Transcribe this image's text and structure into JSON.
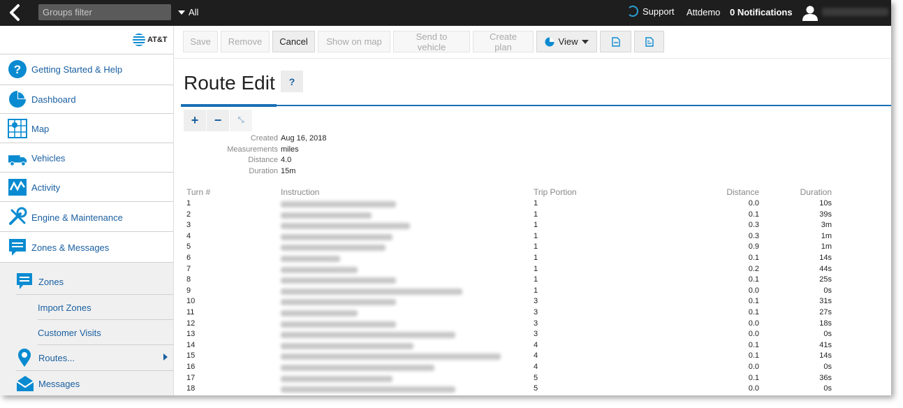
{
  "topbar": {
    "groups_filter_placeholder": "Groups filter",
    "all_label": "All",
    "support_label": "Support",
    "account_label": "Attdemo",
    "notifications_label": "0 Notifications"
  },
  "brand": {
    "logo_text": "AT&T",
    "accent_color": "#1a6fb5",
    "icon_color": "#0a8bd1"
  },
  "sidebar": {
    "items": [
      {
        "label": "Getting Started & Help",
        "icon": "help-icon"
      },
      {
        "label": "Dashboard",
        "icon": "pie-chart-icon"
      },
      {
        "label": "Map",
        "icon": "map-icon"
      },
      {
        "label": "Vehicles",
        "icon": "truck-icon"
      },
      {
        "label": "Activity",
        "icon": "activity-icon"
      },
      {
        "label": "Engine & Maintenance",
        "icon": "wrench-icon"
      },
      {
        "label": "Zones & Messages",
        "icon": "message-icon"
      }
    ],
    "subitems": [
      {
        "label": "Zones",
        "icon": "zone-icon"
      },
      {
        "label": "Import Zones"
      },
      {
        "label": "Customer Visits"
      },
      {
        "label": "Routes...",
        "icon": "pin-icon"
      },
      {
        "label": "Messages",
        "icon": "envelope-icon"
      }
    ]
  },
  "toolbar": {
    "save": "Save",
    "remove": "Remove",
    "cancel": "Cancel",
    "show_on_map": "Show on map",
    "send_to_vehicle": "Send to vehicle",
    "create_plan": "Create plan",
    "view": "View"
  },
  "page": {
    "title": "Route Edit",
    "help": "?"
  },
  "meta": [
    {
      "key": "Created",
      "value": "Aug 16, 2018"
    },
    {
      "key": "Measurements",
      "value": "miles"
    },
    {
      "key": "Distance",
      "value": "4.0"
    },
    {
      "key": "Duration",
      "value": "15m"
    }
  ],
  "table": {
    "headers": {
      "turn": "Turn #",
      "instruction": "Instruction",
      "trip": "Trip Portion",
      "distance": "Distance",
      "duration": "Duration"
    },
    "rows": [
      {
        "turn": "1",
        "trip": "1",
        "distance": "0.0",
        "duration": "10s"
      },
      {
        "turn": "2",
        "trip": "1",
        "distance": "0.1",
        "duration": "39s"
      },
      {
        "turn": "3",
        "trip": "1",
        "distance": "0.3",
        "duration": "3m"
      },
      {
        "turn": "4",
        "trip": "1",
        "distance": "0.3",
        "duration": "1m"
      },
      {
        "turn": "5",
        "trip": "1",
        "distance": "0.9",
        "duration": "1m"
      },
      {
        "turn": "6",
        "trip": "1",
        "distance": "0.1",
        "duration": "14s"
      },
      {
        "turn": "7",
        "trip": "1",
        "distance": "0.2",
        "duration": "44s"
      },
      {
        "turn": "8",
        "trip": "1",
        "distance": "0.1",
        "duration": "25s"
      },
      {
        "turn": "9",
        "trip": "1",
        "distance": "0.0",
        "duration": "0s"
      },
      {
        "turn": "10",
        "trip": "3",
        "distance": "0.1",
        "duration": "31s"
      },
      {
        "turn": "11",
        "trip": "3",
        "distance": "0.1",
        "duration": "27s"
      },
      {
        "turn": "12",
        "trip": "3",
        "distance": "0.0",
        "duration": "18s"
      },
      {
        "turn": "13",
        "trip": "3",
        "distance": "0.0",
        "duration": "0s"
      },
      {
        "turn": "14",
        "trip": "4",
        "distance": "0.1",
        "duration": "41s"
      },
      {
        "turn": "15",
        "trip": "4",
        "distance": "0.1",
        "duration": "14s"
      },
      {
        "turn": "16",
        "trip": "4",
        "distance": "0.0",
        "duration": "0s"
      },
      {
        "turn": "17",
        "trip": "5",
        "distance": "0.1",
        "duration": "36s"
      },
      {
        "turn": "18",
        "trip": "5",
        "distance": "0.0",
        "duration": "0s"
      }
    ]
  }
}
